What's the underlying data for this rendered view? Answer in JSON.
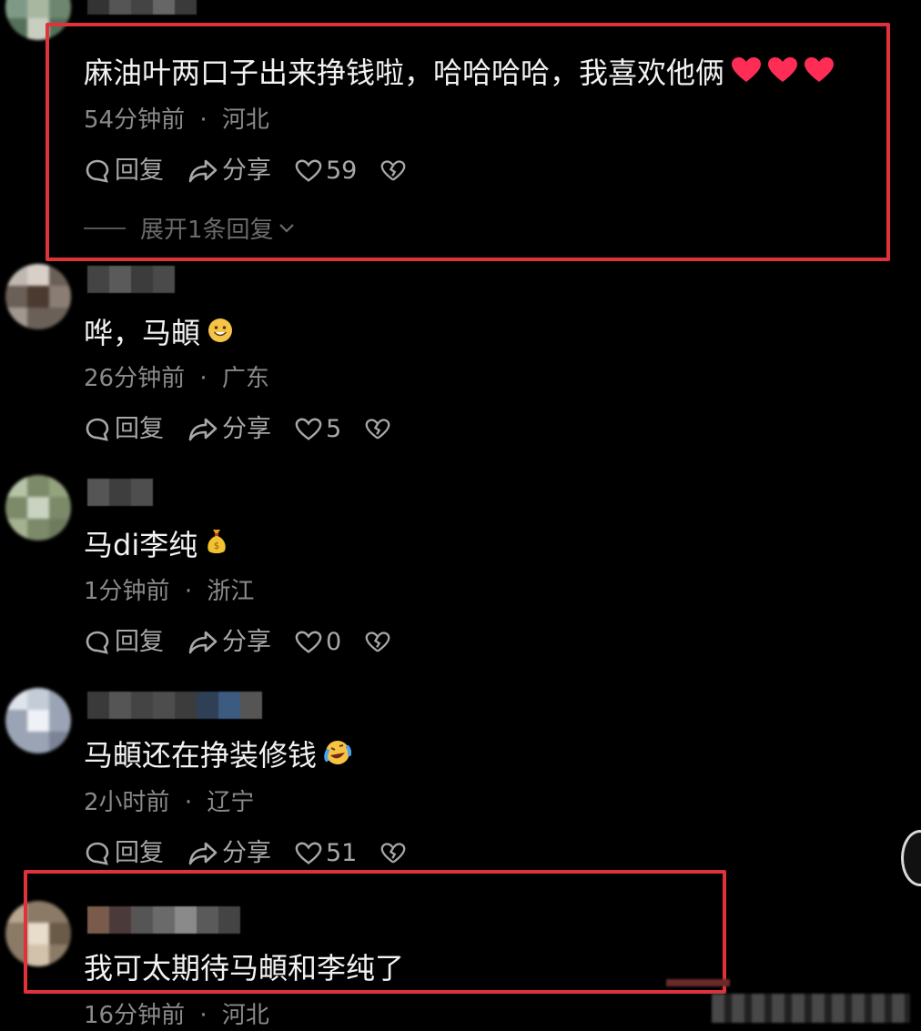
{
  "comments": [
    {
      "text": "麻油叶两口子出来挣钱啦，哈哈哈哈，我喜欢他俩",
      "time": "54分钟前",
      "sep": "·",
      "location": "河北",
      "reply_label": "回复",
      "share_label": "分享",
      "likes": "59",
      "expand_label": "展开1条回复",
      "emoji": "heart-icon"
    },
    {
      "text": "哗，马頔",
      "time": "26分钟前",
      "sep": "·",
      "location": "广东",
      "reply_label": "回复",
      "share_label": "分享",
      "likes": "5",
      "emoji": "smile-icon"
    },
    {
      "text": "马di李纯",
      "time": "1分钟前",
      "sep": "·",
      "location": "浙江",
      "reply_label": "回复",
      "share_label": "分享",
      "likes": "0",
      "emoji": "money-bag-icon"
    },
    {
      "text": "马頔还在挣装修钱",
      "time": "2小时前",
      "sep": "·",
      "location": "辽宁",
      "reply_label": "回复",
      "share_label": "分享",
      "likes": "51",
      "emoji": "laugh-cry-icon"
    },
    {
      "text": "我可太期待马頔和李纯了",
      "time": "16分钟前",
      "sep": "·",
      "location": "河北"
    }
  ],
  "colors": {
    "background": "#000000",
    "highlight_box": "#e0323a",
    "heart": "#ff2c55",
    "meta_text": "#8a8a8a"
  }
}
